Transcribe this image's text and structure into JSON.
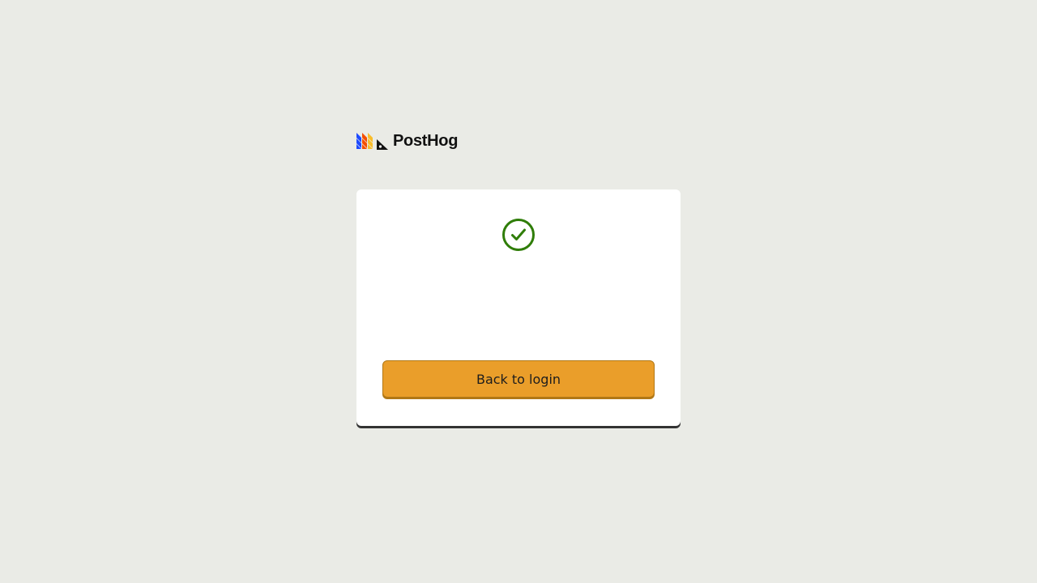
{
  "brand": {
    "name": "PostHog",
    "logo_icon": "posthog-hedgehog-logo-icon"
  },
  "card": {
    "status_icon": "check-circle-icon",
    "status_color": "#2f7d08",
    "button_label": "Back to login",
    "button_color": "#ea9e2a"
  }
}
